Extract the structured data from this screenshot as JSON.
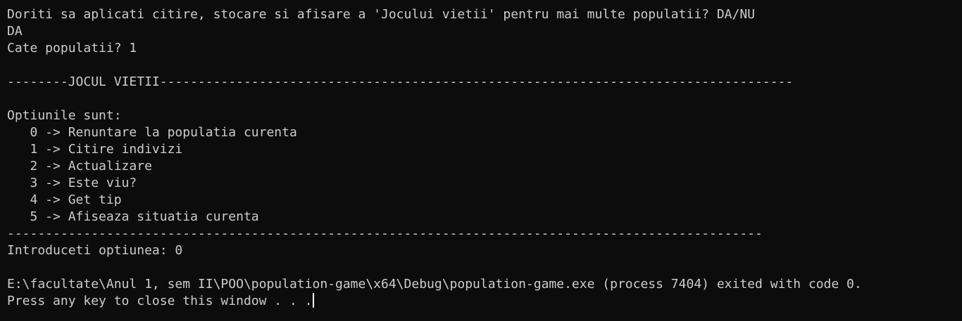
{
  "console": {
    "lines": [
      "---------------------------------------------------------------------------------------------------",
      "Doriti sa aplicati citire, stocare si afisare a 'Jocului vietii' pentru mai multe populatii? DA/NU",
      "DA",
      "Cate populatii? 1",
      "",
      "--------JOCUL VIETII-----------------------------------------------------------------------------------",
      "",
      "Optiunile sunt:",
      "   0 -> Renuntare la populatia curenta",
      "   1 -> Citire indivizi",
      "   2 -> Actualizare",
      "   3 -> Este viu?",
      "   4 -> Get tip",
      "   5 -> Afiseaza situatia curenta",
      "---------------------------------------------------------------------------------------------------",
      "Introduceti optiunea: 0",
      "",
      "E:\\facultate\\Anul 1, sem II\\POO\\population-game\\x64\\Debug\\population-game.exe (process 7404) exited with code 0.",
      "Press any key to close this window . . ."
    ]
  },
  "colors": {
    "background": "#0c0c0c",
    "text": "#cccccc",
    "cursor": "#ffffff"
  }
}
